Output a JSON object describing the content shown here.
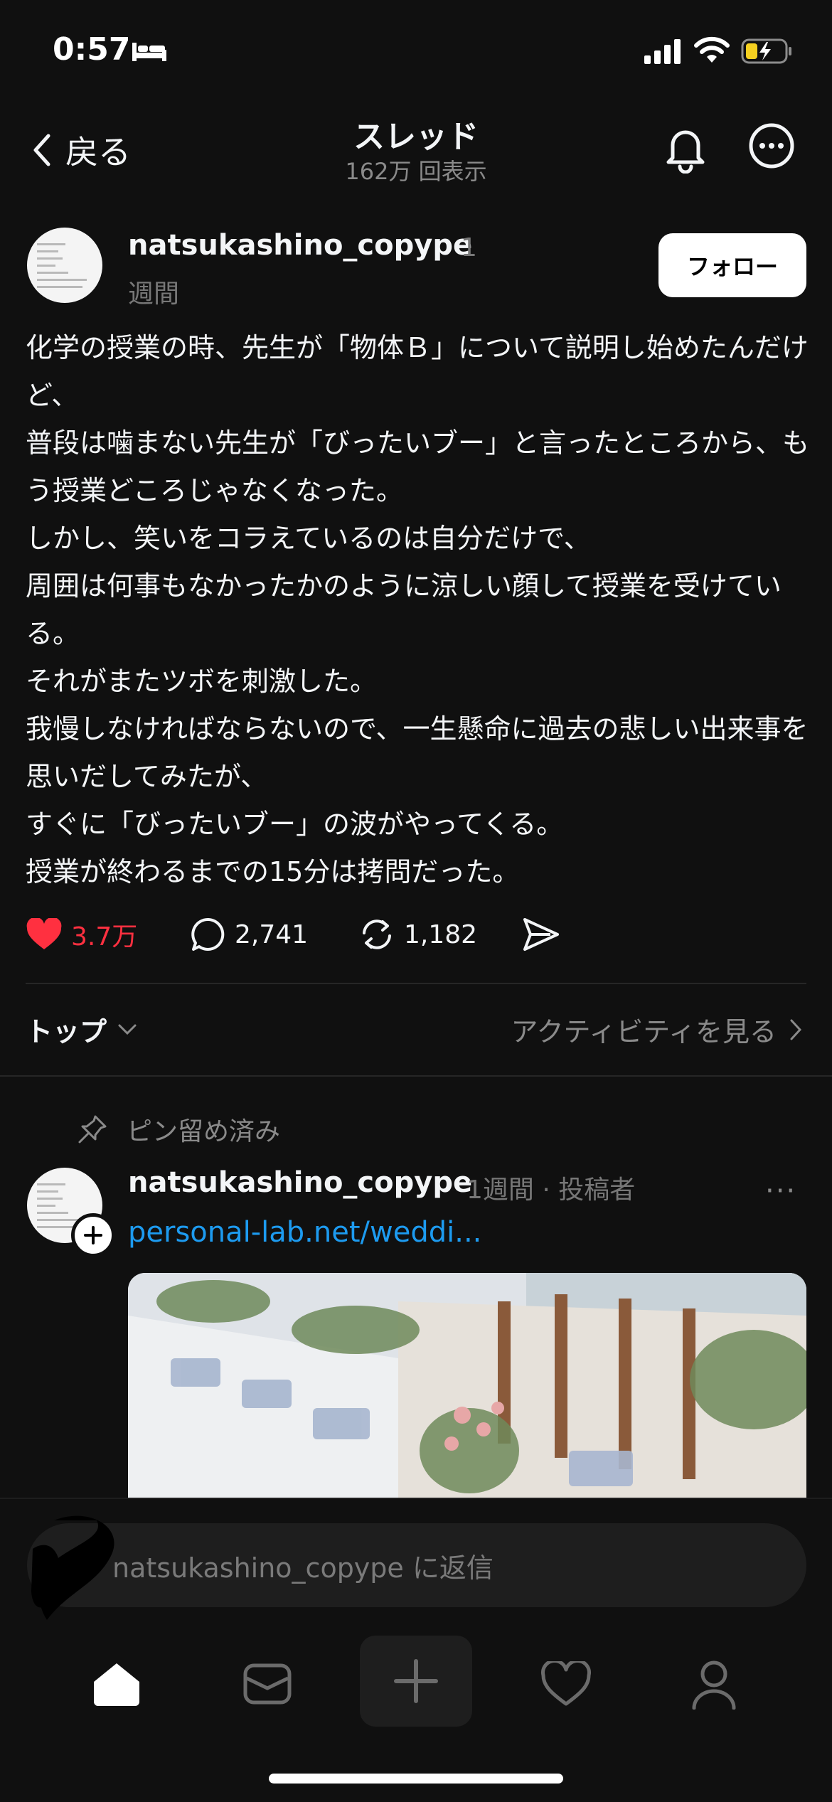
{
  "status_bar": {
    "time": "0:57",
    "icons": [
      "bed-icon",
      "signal-icon",
      "wifi-icon",
      "battery-charging-icon"
    ]
  },
  "header": {
    "back_label": "戻る",
    "title": "スレッド",
    "views": "162万 回表示",
    "icons": [
      "chevron-left-icon",
      "bell-icon",
      "more-circle-icon"
    ]
  },
  "post": {
    "username": "natsukashino_copype",
    "time_part1": "1",
    "time_part2": "週間",
    "follow_label": "フォロー",
    "body_lines": [
      "化学の授業の時、先生が「物体Ｂ」について説明し始めたんだけど、",
      "普段は噛まない先生が「びったいブー」と言ったところから、もう授業どころじゃなくなった。",
      "しかし、笑いをコラえているのは自分だけで、",
      "周囲は何事もなかったかのように涼しい顔して授業を受けている。",
      "それがまたツボを刺激した。",
      "我慢しなければならないので、一生懸命に過去の悲しい出来事を思いだしてみたが、",
      "すぐに「びったいブー」の波がやってくる。",
      "授業が終わるまでの15分は拷問だった。"
    ],
    "likes": "3.7万",
    "comments": "2,741",
    "reposts": "1,182",
    "like_color": "#ff3040"
  },
  "replies_header": {
    "sort_label": "トップ",
    "activity_label": "アクティビティを見る"
  },
  "pinned_reply": {
    "pinned_label": "ピン留め済み",
    "username": "natsukashino_copype",
    "meta": "1週間 · 投稿者",
    "link": "personal-lab.net/weddi...",
    "more": "···",
    "link_color": "#1d9bf0"
  },
  "composer": {
    "placeholder": "natsukashino_copype に返信"
  },
  "nav": {
    "items": [
      "home-icon",
      "inbox-icon",
      "plus-icon",
      "heart-icon",
      "profile-icon"
    ]
  }
}
